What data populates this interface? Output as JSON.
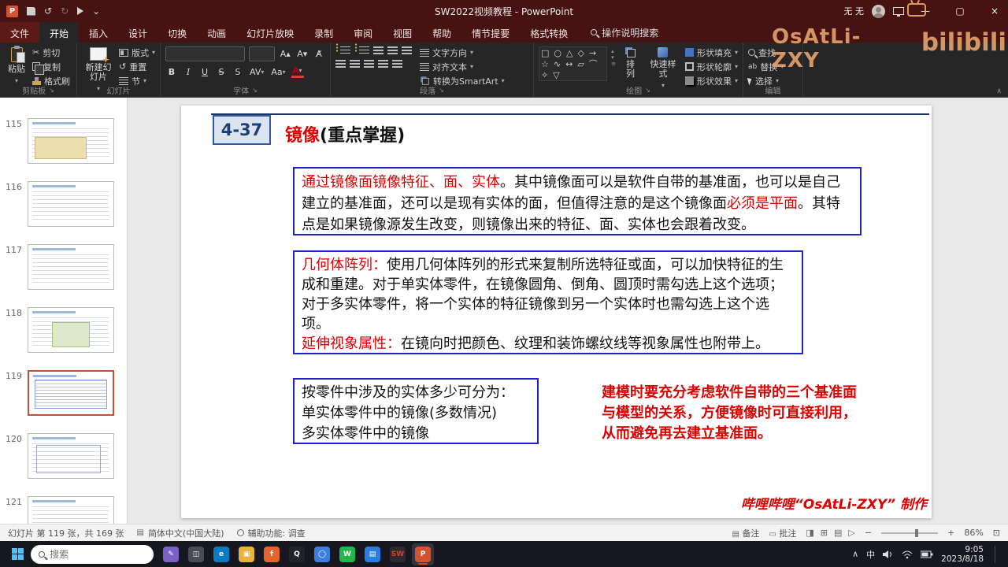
{
  "title_bar": {
    "title": "SW2022视频教程  -  PowerPoint",
    "user": "无 无"
  },
  "watermark": {
    "name": "OsAtLi-ZXY",
    "brand": "bilibili"
  },
  "ribbon": {
    "tabs": [
      {
        "key": "file",
        "label": "文件",
        "file": true
      },
      {
        "key": "home",
        "label": "开始",
        "selected": true
      },
      {
        "key": "insert",
        "label": "插入"
      },
      {
        "key": "design",
        "label": "设计"
      },
      {
        "key": "transitions",
        "label": "切换"
      },
      {
        "key": "animations",
        "label": "动画"
      },
      {
        "key": "slideshow",
        "label": "幻灯片放映"
      },
      {
        "key": "record",
        "label": "录制"
      },
      {
        "key": "review",
        "label": "审阅"
      },
      {
        "key": "view",
        "label": "视图"
      },
      {
        "key": "help",
        "label": "帮助"
      },
      {
        "key": "storyboard",
        "label": "情节提要"
      },
      {
        "key": "format-convert",
        "label": "格式转换"
      }
    ],
    "search_label": "操作说明搜索",
    "clipboard": {
      "label": "剪贴板",
      "paste": "粘贴",
      "cut": "剪切",
      "copy": "复制",
      "format_painter": "格式刷"
    },
    "slides": {
      "label": "幻灯片",
      "new_slide": "新建幻灯片",
      "layout": "版式",
      "reset": "重置",
      "section": "节"
    },
    "font": {
      "label": "字体"
    },
    "paragraph": {
      "label": "段落",
      "text_direction": "文字方向",
      "align_text": "对齐文本",
      "smartart": "转换为SmartArt"
    },
    "drawing": {
      "label": "绘图",
      "arrange": "排列",
      "quick_styles": "快速样式",
      "shape_fill": "形状填充",
      "shape_outline": "形状轮廓",
      "shape_effects": "形状效果",
      "shapes": [
        "□",
        "○",
        "△",
        "◇",
        "→",
        "☆",
        "∿",
        "↔",
        "▱",
        "⌒",
        "✧",
        "▽"
      ]
    },
    "editing": {
      "label": "编辑",
      "find": "查找",
      "replace": "替换",
      "select": "选择"
    }
  },
  "slides_panel": {
    "selected": 119,
    "items": [
      115,
      116,
      117,
      118,
      119,
      120,
      121
    ]
  },
  "slide": {
    "badge": "4-37",
    "title": [
      {
        "text": "镜像",
        "color": "#dd0000"
      },
      {
        "text": "(重点掌握)",
        "color": "#111111"
      }
    ],
    "box1": [
      {
        "text": "通过镜像面镜像特征、面、实体",
        "color": "#dd0000"
      },
      {
        "text": "。其中镜像面可以是软件自带的基准面，也可以是自己建立的基准面，还可以是现有实体的面，但值得注意的是这个镜像面",
        "color": "#111111"
      },
      {
        "text": "必须是平面",
        "color": "#dd0000"
      },
      {
        "text": "。其特点是如果镜像源发生改变，则镜像出来的特征、面、实体也会跟着改变。",
        "color": "#111111"
      }
    ],
    "box2": [
      {
        "text": "几何体阵列：",
        "color": "#dd0000"
      },
      {
        "text": "使用几何体阵列的形式来复制所选特征或面，可以加快特征的生成和重建。对于单实体零件，在镜像圆角、倒角、圆顶时需勾选上这个选项；对于多实体零件，将一个实体的特征镜像到另一个实体时也需勾选上这个选项。\n",
        "color": "#111111"
      },
      {
        "text": "延伸视象属性：",
        "color": "#dd0000"
      },
      {
        "text": "在镜向时把颜色、纹理和装饰螺纹线等视象属性也附带上。",
        "color": "#111111"
      }
    ],
    "box3": "按零件中涉及的实体多少可分为：\n单实体零件中的镜像(多数情况)\n多实体零件中的镜像",
    "note": "建模时要充分考虑软件自带的三个基准面与模型的关系，方便镜像时可直接利用，从而避免再去建立基准面。",
    "footer": "哔哩哔哩“OsAtLi-ZXY” 制作"
  },
  "status_bar": {
    "slide_info": "幻灯片 第 119 张，共 169 张",
    "language": "简体中文(中国大陆)",
    "accessibility": "辅助功能: 调查",
    "notes_label": "备注",
    "comments_label": "批注",
    "zoom": "86%"
  },
  "taskbar": {
    "search": "搜索",
    "ime": "中",
    "time": "9:05",
    "date": "2023/8/18",
    "icons": [
      {
        "name": "pen-app-icon",
        "glyph": "✎",
        "bg": "#7b61c4"
      },
      {
        "name": "task-view-icon",
        "glyph": "◫",
        "bg": "#4a4a58"
      },
      {
        "name": "edge-icon",
        "glyph": "e",
        "bg": "#0b7cc4"
      },
      {
        "name": "file-explorer-icon",
        "glyph": "▣",
        "bg": "#e8b33c"
      },
      {
        "name": "firefox-icon",
        "glyph": "f",
        "bg": "#e3652b"
      },
      {
        "name": "qq-icon",
        "glyph": "Q",
        "bg": "#20232a"
      },
      {
        "name": "browser-icon",
        "glyph": "◯",
        "bg": "#3d7de0"
      },
      {
        "name": "wechat-icon",
        "glyph": "W",
        "bg": "#20b84b"
      },
      {
        "name": "netdisk-icon",
        "glyph": "▤",
        "bg": "#2a7de1"
      },
      {
        "name": "solidworks-icon",
        "glyph": "SW",
        "bg": "#2b2b2b",
        "fg": "#e03c31"
      },
      {
        "name": "powerpoint-icon",
        "glyph": "P",
        "bg": "#d35230",
        "active": true
      }
    ]
  }
}
